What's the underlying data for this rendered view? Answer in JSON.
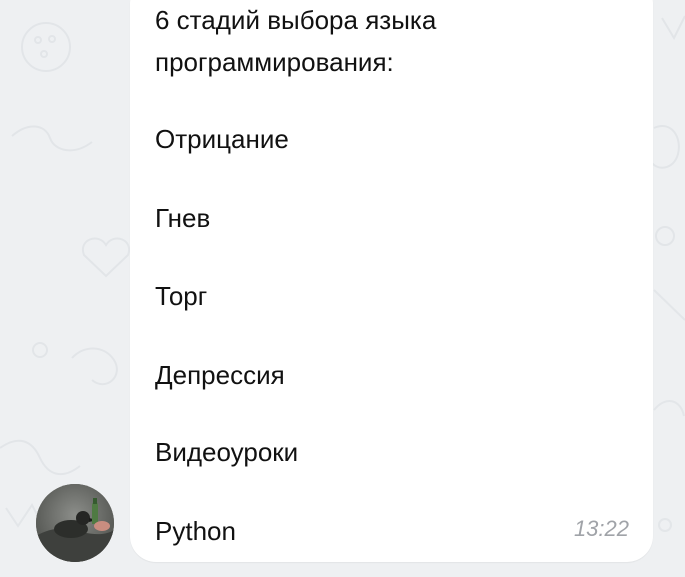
{
  "message": {
    "title_line_1": "6 стадий выбора языка",
    "title_line_2": "программирования:",
    "stages": [
      "Отрицание",
      "Гнев",
      "Торг",
      "Депрессия",
      "Видеоуроки",
      "Python"
    ],
    "time": "13:22"
  },
  "colors": {
    "chat_background": "#eef0f2",
    "bubble": "#ffffff",
    "text": "#111111",
    "timestamp": "#a0a3a8"
  },
  "icons": [
    "avatar-photo"
  ]
}
